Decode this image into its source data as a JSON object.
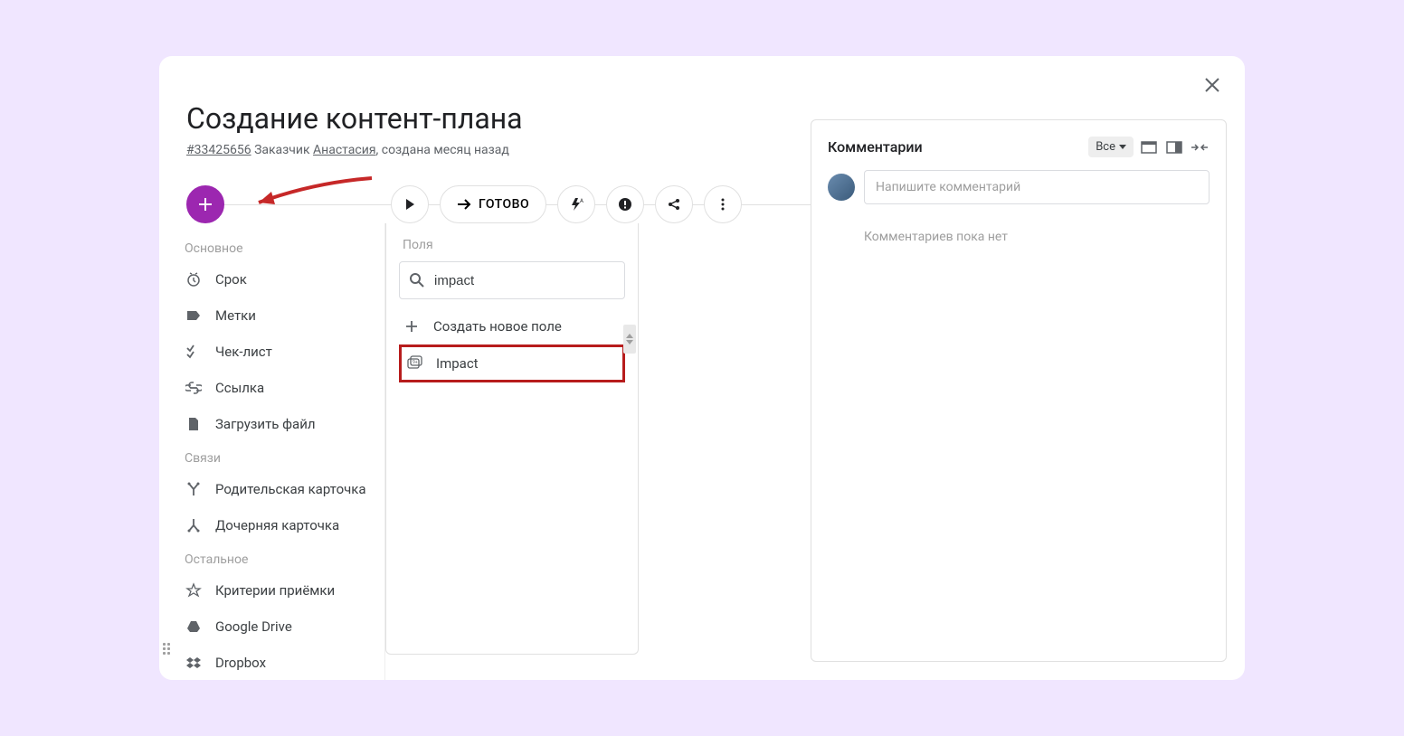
{
  "task": {
    "title": "Создание контент-плана",
    "id_link": "#33425656",
    "customer_label": "Заказчик",
    "customer_name": "Анастасия",
    "created_text": ", создана месяц назад"
  },
  "toolbar": {
    "done_label": "ГОТОВО"
  },
  "add_menu": {
    "sections": {
      "main": {
        "header": "Основное",
        "items": [
          {
            "label": "Срок",
            "icon": "clock"
          },
          {
            "label": "Метки",
            "icon": "tag"
          },
          {
            "label": "Чек-лист",
            "icon": "checklist"
          },
          {
            "label": "Ссылка",
            "icon": "link"
          },
          {
            "label": "Загрузить файл",
            "icon": "file"
          }
        ]
      },
      "relations": {
        "header": "Связи",
        "items": [
          {
            "label": "Родительская карточка",
            "icon": "branch-up"
          },
          {
            "label": "Дочерняя карточка",
            "icon": "branch-down"
          }
        ]
      },
      "other": {
        "header": "Остальное",
        "items": [
          {
            "label": "Критерии приёмки",
            "icon": "star"
          },
          {
            "label": "Google Drive",
            "icon": "gdrive"
          },
          {
            "label": "Dropbox",
            "icon": "dropbox"
          }
        ]
      }
    }
  },
  "fields_panel": {
    "header": "Поля",
    "search_value": "impact",
    "create_label": "Создать новое поле",
    "results": [
      {
        "label": "Impact",
        "highlighted": true
      }
    ]
  },
  "comments": {
    "title": "Комментарии",
    "filter_label": "Все",
    "input_placeholder": "Напишите комментарий",
    "empty_text": "Комментариев пока нет"
  }
}
